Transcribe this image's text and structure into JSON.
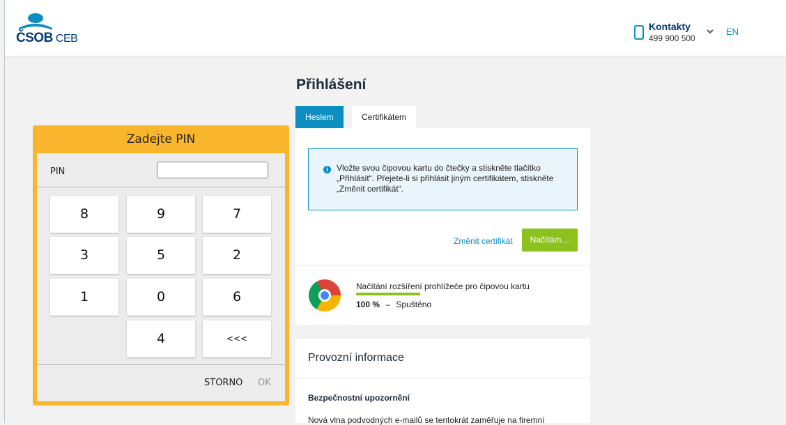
{
  "header": {
    "logo_brand": "ČSOB",
    "logo_sub": "CEB",
    "contacts_label": "Kontakty",
    "contacts_phone": "499 900 500",
    "lang": "EN"
  },
  "login": {
    "title": "Přihlášení",
    "tabs": [
      {
        "label": "Heslem",
        "active": true
      },
      {
        "label": "Certifikátem",
        "active": false
      }
    ],
    "info_text": "Vložte svou čipovou kartu do čtečky a stiskněte tlačítko „Přihlásit“. Přejete-li si přihlásit jiným certifikátem, stiskněte „Změnit certifikát“.",
    "change_cert": "Změnit certifikát",
    "loading_button": "Načítám…",
    "extension": {
      "label": "Načítání rozšíření prohlížeče pro čipovou kartu",
      "percent_text": "100 %",
      "dash": "–",
      "status": "Spuštěno",
      "progress": 1.0
    }
  },
  "operations": {
    "title": "Provozní informace",
    "section_title": "Bezpečnostní upozornění",
    "section_text": "Nová vlna podvodných e-mailů se tentokrát zaměřuje na firemní"
  },
  "pinpad": {
    "title": "Zadejte PIN",
    "pin_label": "PIN",
    "keys": [
      "8",
      "9",
      "7",
      "3",
      "5",
      "2",
      "1",
      "0",
      "6",
      "4",
      "<<<"
    ],
    "cancel": "STORNO",
    "ok": "OK"
  },
  "colors": {
    "accent_blue": "#0a8fc0",
    "accent_green": "#8cc21e",
    "pinpad_yellow": "#f9b52b",
    "brand_navy": "#003b7a"
  }
}
